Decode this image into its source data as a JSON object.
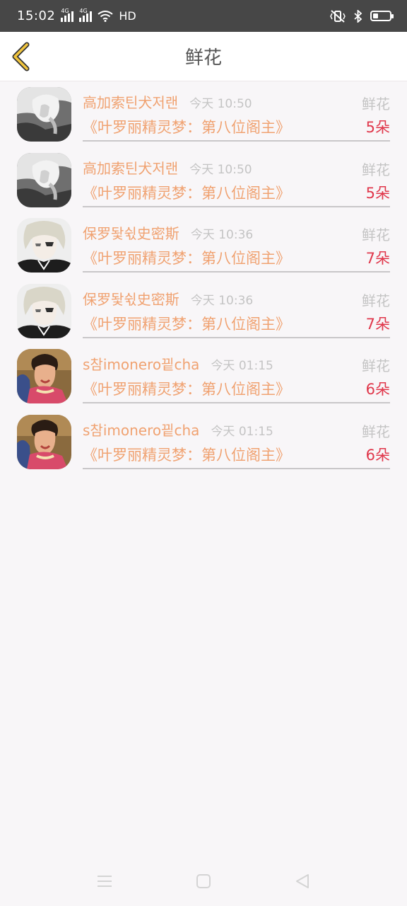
{
  "status_bar": {
    "time": "15:02",
    "network_1": "4G",
    "network_2": "4G",
    "hd_label": "HD",
    "battery_level": 0.3
  },
  "header": {
    "title": "鲜花",
    "back_icon": "chevron-left-icon",
    "accent_color": "#f2c53d"
  },
  "records": [
    {
      "user": "高加索틴犬저랜",
      "time": "今天 10:50",
      "gift": "鲜花",
      "book": "《叶罗丽精灵梦：第八位阁主》",
      "count": "5朵",
      "avatar": "grayscale-portrait"
    },
    {
      "user": "高加索틴犬저랜",
      "time": "今天 10:50",
      "gift": "鲜花",
      "book": "《叶罗丽精灵梦：第八位阁主》",
      "count": "5朵",
      "avatar": "grayscale-portrait"
    },
    {
      "user": "保罗돷쉯史密斯",
      "time": "今天 10:36",
      "gift": "鲜花",
      "book": "《叶罗丽精灵梦：第八位阁主》",
      "count": "7朵",
      "avatar": "anime-character"
    },
    {
      "user": "保罗돷쉯史密斯",
      "time": "今天 10:36",
      "gift": "鲜花",
      "book": "《叶罗丽精灵梦：第八位阁主》",
      "count": "7朵",
      "avatar": "anime-character"
    },
    {
      "user": "s참imonero끹cha",
      "time": "今天 01:15",
      "gift": "鲜花",
      "book": "《叶罗丽精灵梦：第八位阁主》",
      "count": "6朵",
      "avatar": "costume-photo"
    },
    {
      "user": "s참imonero끹cha",
      "time": "今天 01:15",
      "gift": "鲜花",
      "book": "《叶罗丽精灵梦：第八位阁主》",
      "count": "6朵",
      "avatar": "costume-photo"
    }
  ],
  "colors": {
    "name": "#f0a271",
    "book": "#f0a271",
    "count": "#e0374b",
    "meta": "#c4c4c4",
    "background": "#f8f6f8"
  },
  "nav_bar": {
    "menu_icon": "menu-icon",
    "home_icon": "home-square-icon",
    "back_icon": "back-triangle-icon"
  }
}
